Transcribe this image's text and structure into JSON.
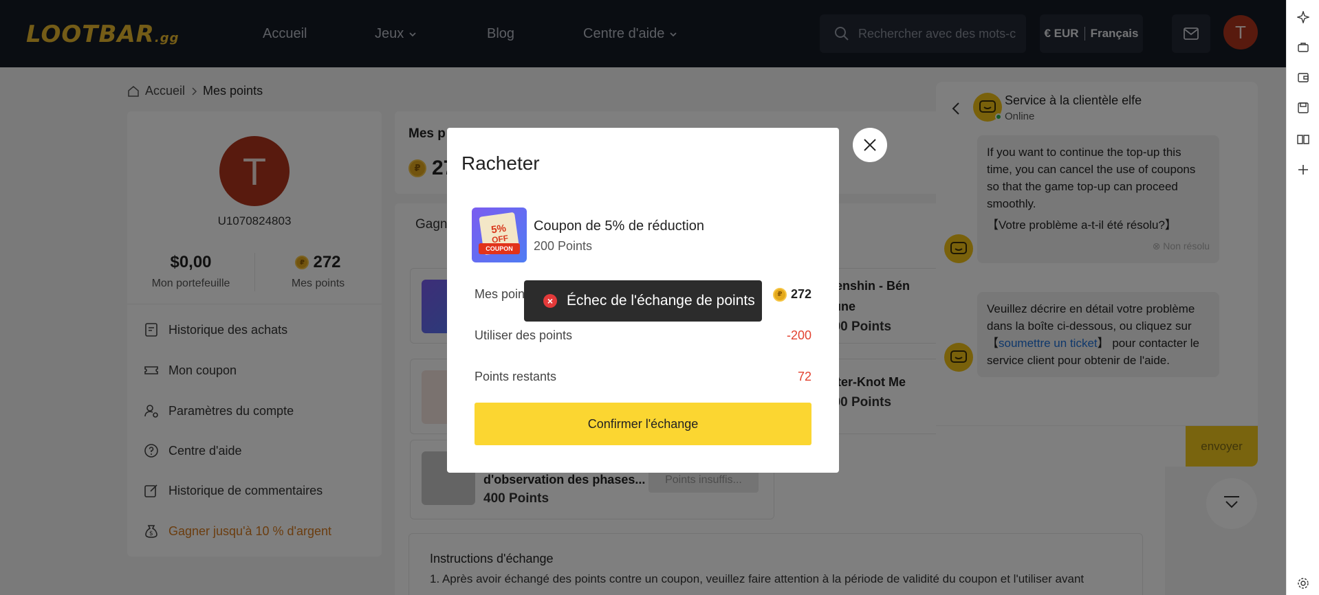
{
  "header": {
    "logo_main": "LOOTBAR",
    "logo_suffix": ".gg",
    "nav": [
      {
        "label": "Accueil"
      },
      {
        "label": "Jeux"
      },
      {
        "label": "Blog"
      },
      {
        "label": "Centre d'aide"
      }
    ],
    "search_placeholder": "Rechercher avec des mots-clés",
    "currency": "€ EUR",
    "language": "Français",
    "avatar_letter": "T"
  },
  "breadcrumb": {
    "home": "Accueil",
    "current": "Mes points"
  },
  "profile": {
    "avatar_letter": "T",
    "user_id": "U1070824803",
    "wallet_value": "$0,00",
    "wallet_label": "Mon portefeuille",
    "points_value": "272",
    "points_label": "Mes points"
  },
  "menu": [
    {
      "label": "Historique des achats",
      "icon": "receipt-icon"
    },
    {
      "label": "Mon coupon",
      "icon": "ticket-icon"
    },
    {
      "label": "Paramètres du compte",
      "icon": "user-settings-icon"
    },
    {
      "label": "Centre d'aide",
      "icon": "help-icon"
    },
    {
      "label": "Historique de commentaires",
      "icon": "edit-icon"
    },
    {
      "label": "Gagner jusqu'à 10 % d'argent",
      "icon": "money-bag-icon"
    }
  ],
  "main": {
    "points_title": "Mes p",
    "points_value": "27",
    "tab_label": "Gagn",
    "products": [
      {
        "name_line1": "Genshin - Bén",
        "name_line2": "Lune",
        "points": "400 Points"
      },
      {
        "name_line1": "Inter-Knot Me",
        "points": "400 Points"
      },
      {
        "name_line1": "d'observation des phases...",
        "points": "400 Points",
        "button": "Points insuffis..."
      }
    ],
    "instructions_title": "Instructions d'échange",
    "instructions_line": "1. Après avoir échangé des points contre un coupon, veuillez faire attention à la période de validité du coupon et l'utiliser avant"
  },
  "chat": {
    "agent_name": "Service à la clientèle elfe",
    "status": "Online",
    "msg1": "If you want to continue the top-up this time, you can cancel the use of coupons so that the game top-up can proceed smoothly.",
    "msg1_question": "【Votre problème a-t-il été résolu?】",
    "msg1_action": "Non résolu",
    "msg2_before": "Veuillez décrire en détail votre problème dans la boîte ci-dessous, ou cliquez sur 【",
    "msg2_link": "soumettre un ticket",
    "msg2_after": "】 pour contacter le service client pour obtenir de l'aide.",
    "send_label": "envoyer"
  },
  "modal": {
    "title": "Racheter",
    "item_name": "Coupon de 5% de réduction",
    "item_points": "200 Points",
    "coupon_pct": "5%",
    "coupon_off": "OFF",
    "coupon_word": "COUPON",
    "row1_label": "Mes points",
    "row1_value": "272",
    "row2_label": "Utiliser des points",
    "row2_value": "-200",
    "row3_label": "Points restants",
    "row3_value": "72",
    "confirm_label": "Confirmer l'échange"
  },
  "toast": {
    "message": "Échec de l'échange de points"
  },
  "colors": {
    "accent": "#fbd631",
    "nav_bg": "#151a25",
    "error": "#e2412f",
    "avatar": "#b0341d"
  }
}
